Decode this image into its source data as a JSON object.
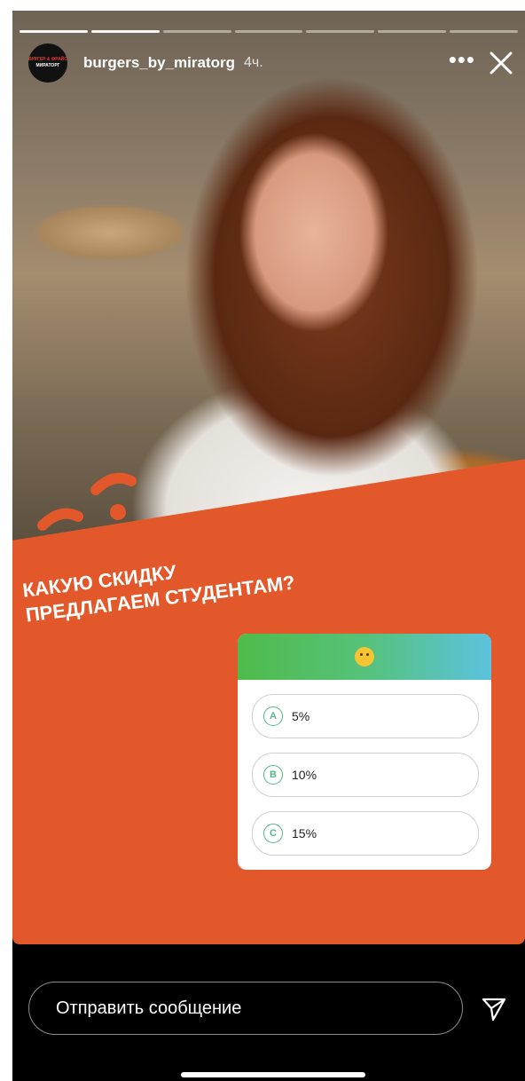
{
  "story": {
    "progress_segments": 7,
    "progress_done": 2,
    "username": "burgers_by_miratorg",
    "time": "4ч.",
    "avatar_line1": "БУРГЕР & ФРАЙС",
    "avatar_line2": "МИРАТОРГ",
    "more_label": "•••",
    "question_line1": "КАКУЮ СКИДКУ",
    "question_line2": "ПРЕДЛАГАЕМ СТУДЕНТАМ?",
    "accent_color": "#e2582a"
  },
  "quiz": {
    "options": [
      {
        "letter": "A",
        "text": "5%"
      },
      {
        "letter": "B",
        "text": "10%"
      },
      {
        "letter": "C",
        "text": "15%"
      }
    ]
  },
  "reply": {
    "placeholder": "Отправить сообщение"
  },
  "icons": {
    "close": "close-icon",
    "send": "send-icon",
    "emoji": "thinking-face-emoji"
  }
}
